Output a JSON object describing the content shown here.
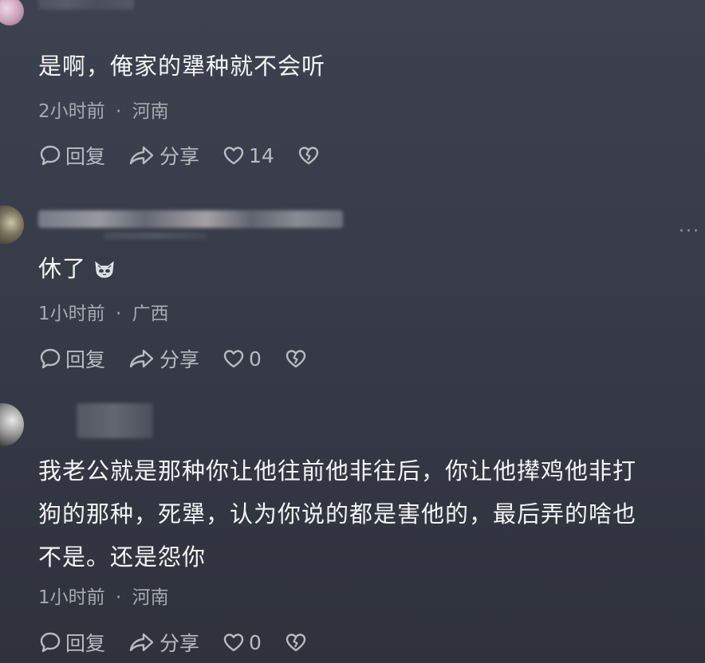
{
  "comments": [
    {
      "text_lines": [
        "是啊，俺家的犟种就不会听"
      ],
      "time": "2小时前",
      "separator": "·",
      "location": "河南",
      "reply_label": "回复",
      "share_label": "分享",
      "likes": "14"
    },
    {
      "text_lines": [
        "休了"
      ],
      "time": "1小时前",
      "separator": "·",
      "location": "广西",
      "reply_label": "回复",
      "share_label": "分享",
      "likes": "0",
      "more_label": "···"
    },
    {
      "text_lines": [
        "我老公就是那种你让他往前他非往后，你让他撵鸡他非打",
        "狗的那种，死犟，认为你说的都是害他的，最后弄的啥也",
        "不是。还是怨你"
      ],
      "time": "1小时前",
      "separator": "·",
      "location": "河南",
      "reply_label": "回复",
      "share_label": "分享",
      "likes": "0"
    }
  ],
  "icons": {
    "reply": "comment-bubble-icon",
    "share": "share-arrow-icon",
    "like": "heart-icon",
    "dislike": "broken-heart-icon",
    "emoji": "cat-emoji-icon"
  },
  "colors": {
    "background_top": "#3e4250",
    "background_bottom": "#2f323d",
    "text": "#f4f4f6",
    "meta": "#a7a9b1",
    "actions": "#b9bbc2"
  }
}
